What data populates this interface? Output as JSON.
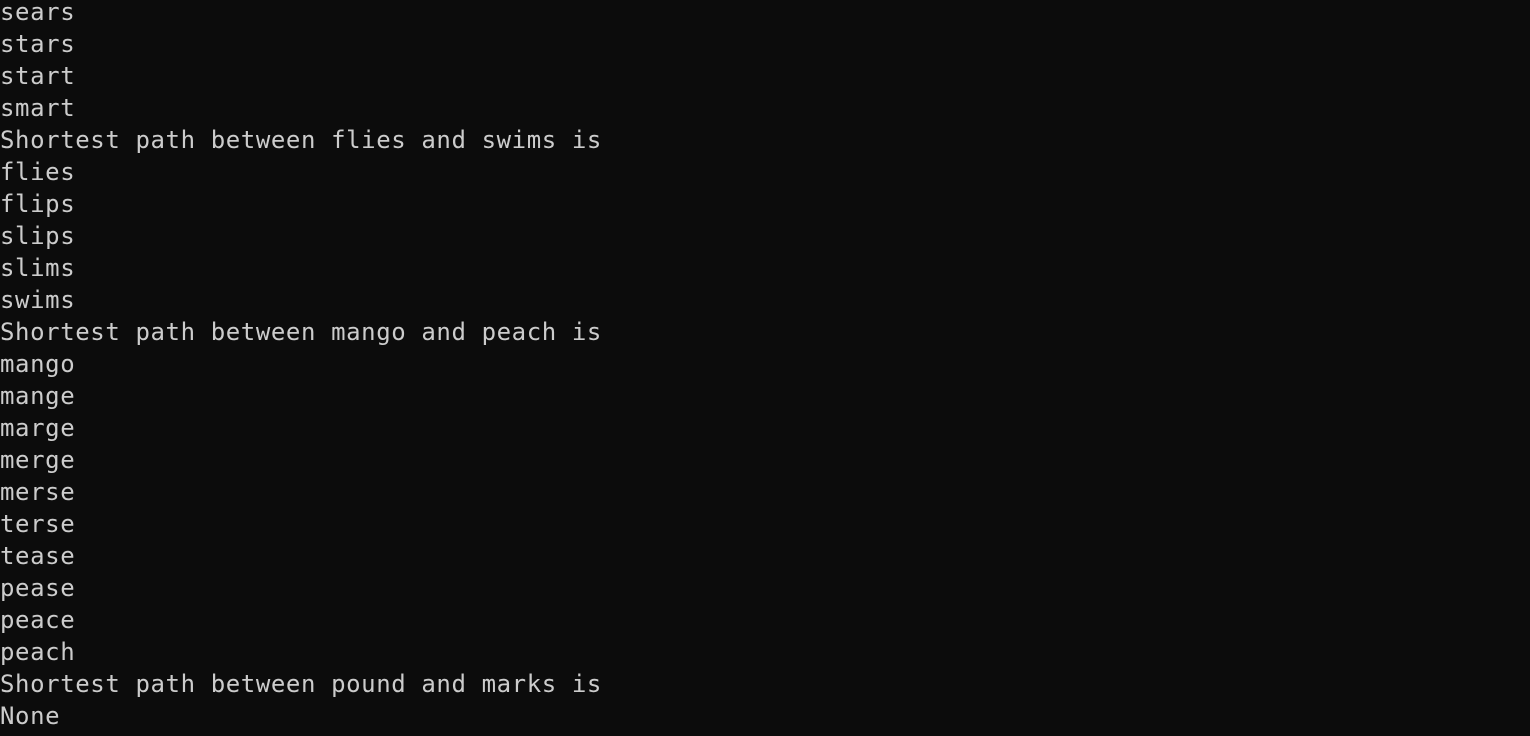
{
  "terminal": {
    "lines": [
      "sears",
      "stars",
      "start",
      "smart",
      "Shortest path between flies and swims is",
      "flies",
      "flips",
      "slips",
      "slims",
      "swims",
      "Shortest path between mango and peach is",
      "mango",
      "mange",
      "marge",
      "merge",
      "merse",
      "terse",
      "tease",
      "pease",
      "peace",
      "peach",
      "Shortest path between pound and marks is",
      "None"
    ],
    "colors": {
      "background": "#0c0c0c",
      "foreground": "#cccccc"
    }
  }
}
